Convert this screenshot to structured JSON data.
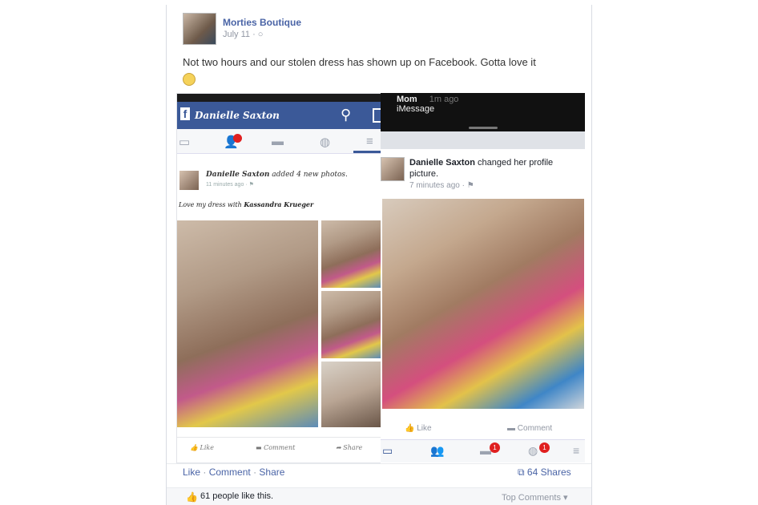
{
  "post": {
    "page_name": "Morties Boutique",
    "date": "July 11 · ○",
    "text": "Not two hours and our stolen dress has shown up on Facebook. Gotta love it"
  },
  "left_shot": {
    "app_title": "Danielle Saxton",
    "inner_name": "Danielle Saxton",
    "inner_action": " added 4 new photos.",
    "inner_time": "11 minutes ago · ⚑",
    "caption": "Love my dress with ",
    "caption_tag": "Kassandra Krueger",
    "nav_badge": "1",
    "actions": {
      "like": "Like",
      "comment": "Comment",
      "share": "Share"
    }
  },
  "right_shot": {
    "notification_title": "Mom",
    "notification_time": "1m ago",
    "notification_sub": "iMessage",
    "name": "Danielle Saxton",
    "action": " changed her profile picture.",
    "time": "7 minutes ago · ⚑",
    "actions": {
      "like": "Like",
      "comment": "Comment"
    },
    "badges": [
      "1",
      "1"
    ]
  },
  "footer": {
    "like": "Like",
    "comment": "Comment",
    "share": "Share",
    "sep": "·",
    "shares": "64 Shares",
    "likes_text": "61 people like this.",
    "top_comments": "Top Comments ▾"
  },
  "colors": {
    "facebook_blue": "#3b5998",
    "link_blue": "#4a64a6",
    "badge_red": "#e02020"
  },
  "icons": [
    "facebook-logo-icon",
    "search-icon",
    "messenger-icon",
    "news-feed-icon",
    "friends-icon",
    "messages-icon",
    "globe-icon",
    "menu-icon",
    "like-thumb-icon",
    "comment-icon",
    "share-icon",
    "smiley-emoji"
  ]
}
